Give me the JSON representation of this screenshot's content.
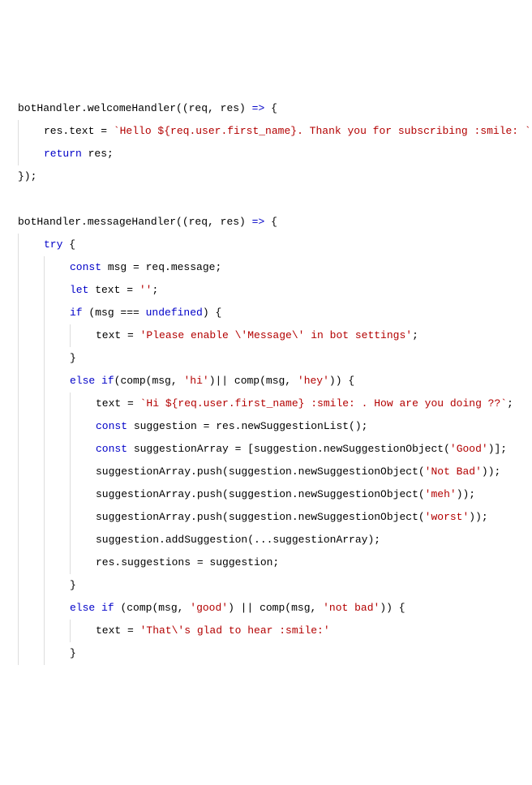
{
  "lines": [
    {
      "indent": 0,
      "tokens": [
        {
          "t": "botHandler.welcomeHandler((req, res) "
        },
        {
          "t": "=>",
          "c": "kw"
        },
        {
          "t": " {"
        }
      ]
    },
    {
      "indent": 1,
      "tokens": [
        {
          "t": "res.text = "
        },
        {
          "t": "`Hello ${req.user.first_name}. Thank you for subscribing :smile: `",
          "c": "tpl"
        },
        {
          "t": ";"
        }
      ]
    },
    {
      "indent": 1,
      "tokens": [
        {
          "t": "return",
          "c": "kw"
        },
        {
          "t": " res;"
        }
      ]
    },
    {
      "indent": 0,
      "tokens": [
        {
          "t": "});"
        }
      ]
    },
    {
      "indent": 0,
      "tokens": [
        {
          "t": " "
        }
      ]
    },
    {
      "indent": 0,
      "tokens": [
        {
          "t": "botHandler.messageHandler((req, res) "
        },
        {
          "t": "=>",
          "c": "kw"
        },
        {
          "t": " {"
        }
      ]
    },
    {
      "indent": 1,
      "tokens": [
        {
          "t": "try",
          "c": "kw"
        },
        {
          "t": " {"
        }
      ]
    },
    {
      "indent": 2,
      "tokens": [
        {
          "t": "const",
          "c": "kw"
        },
        {
          "t": " msg = req.message;"
        }
      ]
    },
    {
      "indent": 2,
      "tokens": [
        {
          "t": "let",
          "c": "kw"
        },
        {
          "t": " text = "
        },
        {
          "t": "''",
          "c": "str"
        },
        {
          "t": ";"
        }
      ]
    },
    {
      "indent": 2,
      "tokens": [
        {
          "t": "if",
          "c": "kw"
        },
        {
          "t": " (msg === "
        },
        {
          "t": "undefined",
          "c": "kw"
        },
        {
          "t": ") {"
        }
      ]
    },
    {
      "indent": 3,
      "tokens": [
        {
          "t": "text = "
        },
        {
          "t": "'Please enable \\'Message\\' in bot settings'",
          "c": "str"
        },
        {
          "t": ";"
        }
      ]
    },
    {
      "indent": 2,
      "tokens": [
        {
          "t": "}"
        }
      ]
    },
    {
      "indent": 2,
      "tokens": [
        {
          "t": "else",
          "c": "kw"
        },
        {
          "t": " "
        },
        {
          "t": "if",
          "c": "kw"
        },
        {
          "t": "(comp(msg, "
        },
        {
          "t": "'hi'",
          "c": "str"
        },
        {
          "t": ")|| comp(msg, "
        },
        {
          "t": "'hey'",
          "c": "str"
        },
        {
          "t": ")) {"
        }
      ]
    },
    {
      "indent": 3,
      "tokens": [
        {
          "t": "text = "
        },
        {
          "t": "`Hi ${req.user.first_name} :smile: . How are you doing ??`",
          "c": "tpl"
        },
        {
          "t": ";"
        }
      ]
    },
    {
      "indent": 3,
      "tokens": [
        {
          "t": "const",
          "c": "kw"
        },
        {
          "t": " suggestion = res.newSuggestionList();"
        }
      ]
    },
    {
      "indent": 3,
      "tokens": [
        {
          "t": "const",
          "c": "kw"
        },
        {
          "t": " suggestionArray = [suggestion.newSuggestionObject("
        },
        {
          "t": "'Good'",
          "c": "str"
        },
        {
          "t": ")];"
        }
      ]
    },
    {
      "indent": 3,
      "tokens": [
        {
          "t": "suggestionArray.push(suggestion.newSuggestionObject("
        },
        {
          "t": "'Not Bad'",
          "c": "str"
        },
        {
          "t": "));"
        }
      ]
    },
    {
      "indent": 3,
      "tokens": [
        {
          "t": "suggestionArray.push(suggestion.newSuggestionObject("
        },
        {
          "t": "'meh'",
          "c": "str"
        },
        {
          "t": "));"
        }
      ]
    },
    {
      "indent": 3,
      "tokens": [
        {
          "t": "suggestionArray.push(suggestion.newSuggestionObject("
        },
        {
          "t": "'worst'",
          "c": "str"
        },
        {
          "t": "));"
        }
      ]
    },
    {
      "indent": 3,
      "tokens": [
        {
          "t": "suggestion.addSuggestion(...suggestionArray);"
        }
      ]
    },
    {
      "indent": 3,
      "tokens": [
        {
          "t": "res.suggestions = suggestion;"
        }
      ]
    },
    {
      "indent": 2,
      "tokens": [
        {
          "t": "}"
        }
      ]
    },
    {
      "indent": 2,
      "tokens": [
        {
          "t": "else",
          "c": "kw"
        },
        {
          "t": " "
        },
        {
          "t": "if",
          "c": "kw"
        },
        {
          "t": " (comp(msg, "
        },
        {
          "t": "'good'",
          "c": "str"
        },
        {
          "t": ") || comp(msg, "
        },
        {
          "t": "'not bad'",
          "c": "str"
        },
        {
          "t": ")) {"
        }
      ]
    },
    {
      "indent": 3,
      "tokens": [
        {
          "t": "text = "
        },
        {
          "t": "'That\\'s glad to hear :smile:'",
          "c": "str"
        }
      ]
    },
    {
      "indent": 2,
      "tokens": [
        {
          "t": "}"
        }
      ]
    }
  ]
}
